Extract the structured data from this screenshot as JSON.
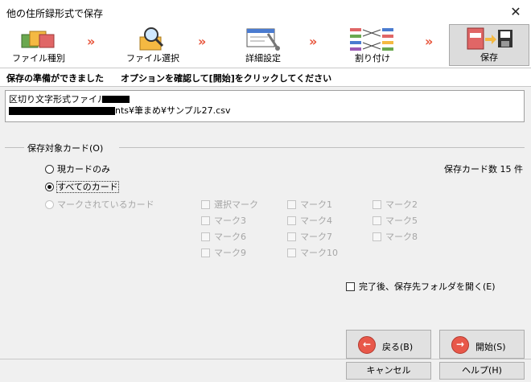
{
  "window": {
    "title": "他の住所録形式で保存",
    "close_glyph": "✕"
  },
  "steps": [
    {
      "label": "ファイル種別",
      "icon": "folders-icon"
    },
    {
      "label": "ファイル選択",
      "icon": "magnifier-folder-icon"
    },
    {
      "label": "詳細設定",
      "icon": "settings-tools-icon"
    },
    {
      "label": "割り付け",
      "icon": "mapping-lines-icon"
    },
    {
      "label": "保存",
      "icon": "save-addressbook-icon"
    }
  ],
  "step_arrow": "»",
  "header": {
    "status": "保存の準備ができました",
    "instruction": "オプションを確認して[開始]をクリックしてください"
  },
  "file": {
    "type": "区切り文字形式ファイル",
    "path_suffix": "nts¥筆まめ¥サンプル27.csv"
  },
  "target_group": {
    "label": "保存対象カード(O)"
  },
  "radios": {
    "current": "現カードのみ",
    "all": "すべてのカード",
    "marked": "マークされているカード"
  },
  "save_count": "保存カード数 15 件",
  "marks": [
    "選択マーク",
    "マーク1",
    "マーク2",
    "マーク3",
    "マーク4",
    "マーク5",
    "マーク6",
    "マーク7",
    "マーク8",
    "マーク9",
    "マーク10"
  ],
  "open_folder_option": "完了後、保存先フォルダを開く(E)",
  "buttons": {
    "back": "戻る(B)",
    "start": "開始(S)",
    "cancel": "キャンセル",
    "help": "ヘルプ(H)"
  },
  "colors": {
    "arrow": "#e8543a",
    "button_icon": "#e8584a"
  }
}
